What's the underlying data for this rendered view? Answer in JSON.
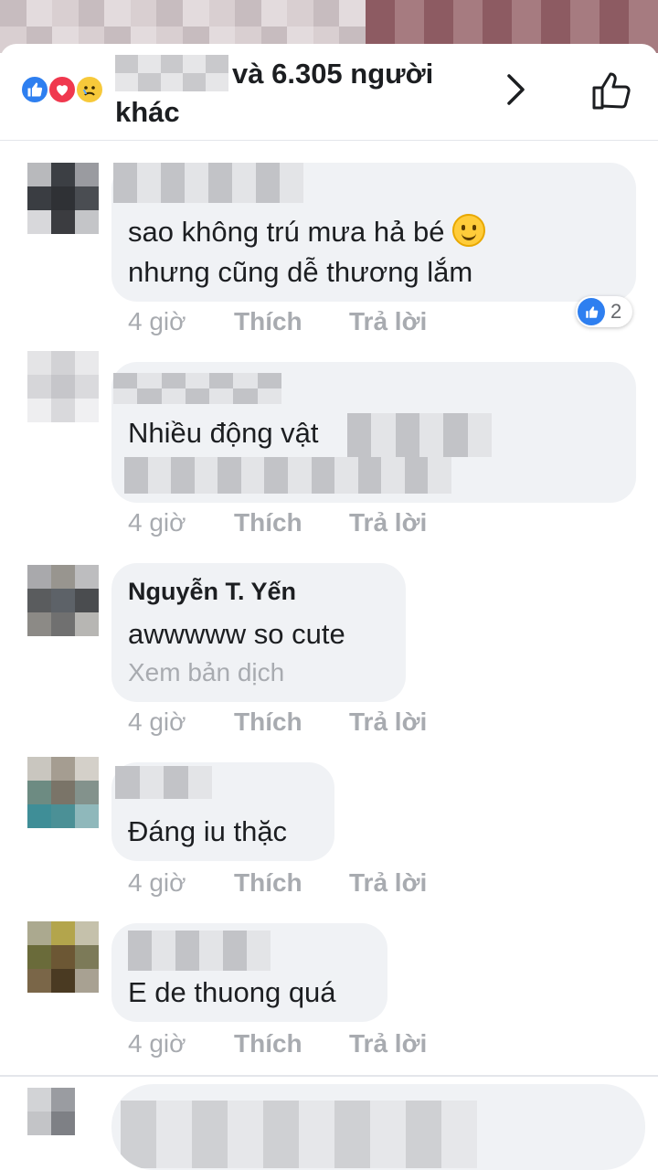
{
  "header": {
    "reaction_icons": [
      "like-icon",
      "love-icon",
      "sad-icon"
    ],
    "reactors_text": "và 6.305 người khác"
  },
  "comments": [
    {
      "author": "",
      "text_line1": "sao không trú mưa hả bé",
      "text_line2": "nhưng cũng dễ thương lắm",
      "time": "4 giờ",
      "like": "Thích",
      "reply": "Trả lời",
      "reaction_count": "2"
    },
    {
      "author": "",
      "text_line1": "Nhiều động vật",
      "time": "4 giờ",
      "like": "Thích",
      "reply": "Trả lời"
    },
    {
      "author": "Nguyễn T. Yến",
      "text_line1": "awwwww so cute",
      "translation": "Xem bản dịch",
      "time": "4 giờ",
      "like": "Thích",
      "reply": "Trả lời"
    },
    {
      "author": "",
      "text_line1": "Đáng iu thặc",
      "time": "4 giờ",
      "like": "Thích",
      "reply": "Trả lời"
    },
    {
      "author": "",
      "text_line1": "E de thuong quá",
      "time": "4 giờ",
      "like": "Thích",
      "reply": "Trả lời"
    }
  ],
  "colors": {
    "like_blue": "#2e7ff0",
    "love_red": "#f0384e",
    "bubble_bg": "#f0f2f5",
    "meta_gray": "#a8abb0"
  }
}
